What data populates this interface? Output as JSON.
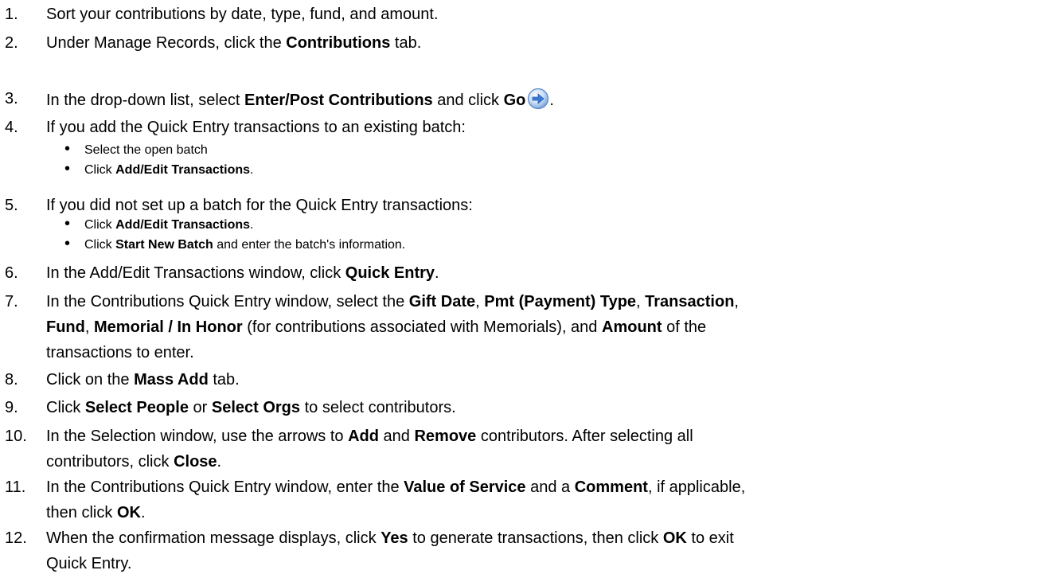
{
  "steps": [
    {
      "num": "1.",
      "parts": [
        {
          "t": "Sort your contributions by date, type, fund, and amount."
        }
      ]
    },
    {
      "num": "2.",
      "parts": [
        {
          "t": "Under Manage Records, click the "
        },
        {
          "t": "Contributions",
          "b": true
        },
        {
          "t": " tab."
        }
      ]
    },
    {
      "num": "3.",
      "parts": [
        {
          "t": "In the drop-down list, select "
        },
        {
          "t": "Enter/Post Contributions",
          "b": true
        },
        {
          "t": " and click "
        },
        {
          "t": "Go",
          "b": true
        },
        {
          "icon": "go-arrow-icon"
        },
        {
          "t": "."
        }
      ]
    },
    {
      "num": "4.",
      "parts": [
        {
          "t": "If you add the Quick Entry transactions to an existing batch:"
        }
      ]
    },
    {
      "num": "5.",
      "parts": [
        {
          "t": "If you did not set up a batch for the Quick Entry transactions:"
        }
      ]
    },
    {
      "num": "6.",
      "parts": [
        {
          "t": "In the Add/Edit Transactions window, click "
        },
        {
          "t": "Quick Entry",
          "b": true
        },
        {
          "t": "."
        }
      ]
    },
    {
      "num": "7.",
      "parts": [
        {
          "t": "In the Contributions Quick Entry window, select the "
        },
        {
          "t": "Gift Date",
          "b": true
        },
        {
          "t": ", "
        },
        {
          "t": "Pmt (Payment) Type",
          "b": true
        },
        {
          "t": ", "
        },
        {
          "t": "Transaction",
          "b": true
        },
        {
          "t": ","
        }
      ],
      "lines": [
        [
          {
            "t": "Fund",
            "b": true
          },
          {
            "t": ", "
          },
          {
            "t": "Memorial / In Honor",
            "b": true
          },
          {
            "t": " (for contributions associated with Memorials), and "
          },
          {
            "t": "Amount",
            "b": true
          },
          {
            "t": " of the"
          }
        ],
        [
          {
            "t": "transactions to enter."
          }
        ]
      ]
    },
    {
      "num": "8.",
      "parts": [
        {
          "t": "Click on the "
        },
        {
          "t": "Mass Add",
          "b": true
        },
        {
          "t": " tab."
        }
      ]
    },
    {
      "num": "9.",
      "parts": [
        {
          "t": "Click "
        },
        {
          "t": "Select People",
          "b": true
        },
        {
          "t": " or "
        },
        {
          "t": "Select Orgs",
          "b": true
        },
        {
          "t": " to select contributors."
        }
      ]
    },
    {
      "num": "10.",
      "parts": [
        {
          "t": "In the Selection window, use the arrows to "
        },
        {
          "t": "Add",
          "b": true
        },
        {
          "t": " and "
        },
        {
          "t": "Remove",
          "b": true
        },
        {
          "t": " contributors. After selecting all"
        }
      ],
      "lines": [
        [
          {
            "t": "contributors, click "
          },
          {
            "t": "Close",
            "b": true
          },
          {
            "t": "."
          }
        ]
      ]
    },
    {
      "num": "11.",
      "parts": [
        {
          "t": "In the Contributions Quick Entry window, enter the "
        },
        {
          "t": "Value of Service",
          "b": true
        },
        {
          "t": " and a "
        },
        {
          "t": "Comment",
          "b": true
        },
        {
          "t": ", if applicable,"
        }
      ],
      "lines": [
        [
          {
            "t": "then click "
          },
          {
            "t": "OK",
            "b": true
          },
          {
            "t": "."
          }
        ]
      ]
    },
    {
      "num": "12.",
      "parts": [
        {
          "t": "When the confirmation message displays, click "
        },
        {
          "t": "Yes",
          "b": true
        },
        {
          "t": " to generate transactions, then click "
        },
        {
          "t": "OK",
          "b": true
        },
        {
          "t": " to exit"
        }
      ],
      "lines": [
        [
          {
            "t": "Quick Entry."
          }
        ]
      ]
    }
  ],
  "substeps": {
    "4": [
      [
        {
          "t": "Select the open batch"
        }
      ],
      [
        {
          "t": "Click "
        },
        {
          "t": "Add/Edit Transactions",
          "b": true
        },
        {
          "t": "."
        }
      ]
    ],
    "5": [
      [
        {
          "t": "Click "
        },
        {
          "t": "Add/Edit Transactions",
          "b": true
        },
        {
          "t": "."
        }
      ],
      [
        {
          "t": "Click "
        },
        {
          "t": "Start New Batch",
          "b": true
        },
        {
          "t": " and enter the batch's information."
        }
      ]
    ]
  },
  "bullet_glyph": "•",
  "colors": {
    "text": "#000000",
    "go_icon_blue": "#3a7bd5"
  }
}
